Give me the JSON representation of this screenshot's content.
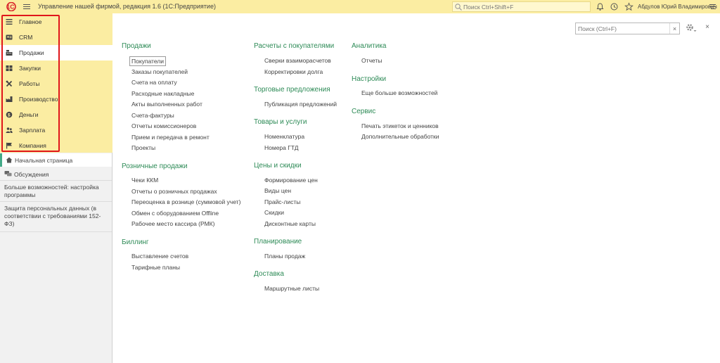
{
  "app": {
    "title": "Управление нашей фирмой, редакция 1.6  (1С:Предприятие)",
    "logo_text": "1С",
    "search_placeholder": "Поиск Ctrl+Shift+F",
    "user": "Абдулов Юрий Владимирович"
  },
  "sidebar": {
    "nav": [
      {
        "label": "Главное",
        "icon": "menu-lines-icon"
      },
      {
        "label": "CRM",
        "icon": "contacts-icon"
      },
      {
        "label": "Продажи",
        "icon": "cash-register-icon"
      },
      {
        "label": "Закупки",
        "icon": "warehouse-icon"
      },
      {
        "label": "Работы",
        "icon": "tools-icon"
      },
      {
        "label": "Производство",
        "icon": "factory-icon"
      },
      {
        "label": "Деньги",
        "icon": "money-icon"
      },
      {
        "label": "Зарплата",
        "icon": "employees-icon"
      },
      {
        "label": "Компания",
        "icon": "flag-icon"
      }
    ],
    "active_nav": "Продажи",
    "panel": {
      "home": "Начальная страница",
      "discussions": "Обсуждения",
      "more": "Больше возможностей: настройка программы",
      "gdpr": "Защита персональных данных (в соответствии с требованиями 152-ФЗ)"
    }
  },
  "main": {
    "search_placeholder": "Поиск (Ctrl+F)",
    "clear_label": "×",
    "close_label": "×",
    "columns": [
      {
        "sections": [
          {
            "title": "Продажи",
            "links": [
              "Покупатели",
              "Заказы покупателей",
              "Счета на оплату",
              "Расходные накладные",
              "Акты выполненных работ",
              "Счета-фактуры",
              "Отчеты комиссионеров",
              "Прием и передача в ремонт",
              "Проекты"
            ]
          },
          {
            "title": "Розничные продажи",
            "links": [
              "Чеки ККМ",
              "Отчеты о розничных продажах",
              "Переоценка в рознице (суммовой учет)",
              "Обмен с оборудованием Offline",
              "Рабочее место кассира (РМК)"
            ]
          },
          {
            "title": "Биллинг",
            "links": [
              "Выставление счетов",
              "Тарифные планы"
            ]
          }
        ]
      },
      {
        "sections": [
          {
            "title": "Расчеты с покупателями",
            "links": [
              "Сверки взаиморасчетов",
              "Корректировки долга"
            ]
          },
          {
            "title": "Торговые предложения",
            "links": [
              "Публикация предложений"
            ]
          },
          {
            "title": "Товары и услуги",
            "links": [
              "Номенклатура",
              "Номера ГТД"
            ]
          },
          {
            "title": "Цены и скидки",
            "links": [
              "Формирование цен",
              "Виды цен",
              "Прайс-листы",
              "Скидки",
              "Дисконтные карты"
            ]
          },
          {
            "title": "Планирование",
            "links": [
              "Планы продаж"
            ]
          },
          {
            "title": "Доставка",
            "links": [
              "Маршрутные листы"
            ]
          }
        ]
      },
      {
        "sections": [
          {
            "title": "Аналитика",
            "links": [
              "Отчеты"
            ]
          },
          {
            "title": "Настройки",
            "links": [
              "Еще больше возможностей"
            ]
          },
          {
            "title": "Сервис",
            "links": [
              "Печать этикеток и ценников",
              "Дополнительные обработки"
            ]
          }
        ]
      }
    ],
    "selected_link": "Покупатели"
  },
  "colors": {
    "title_bar": "#fbeda2",
    "section_title": "#2e8b57",
    "highlight_frame": "#e0161b",
    "logo_red": "#d9232a"
  }
}
